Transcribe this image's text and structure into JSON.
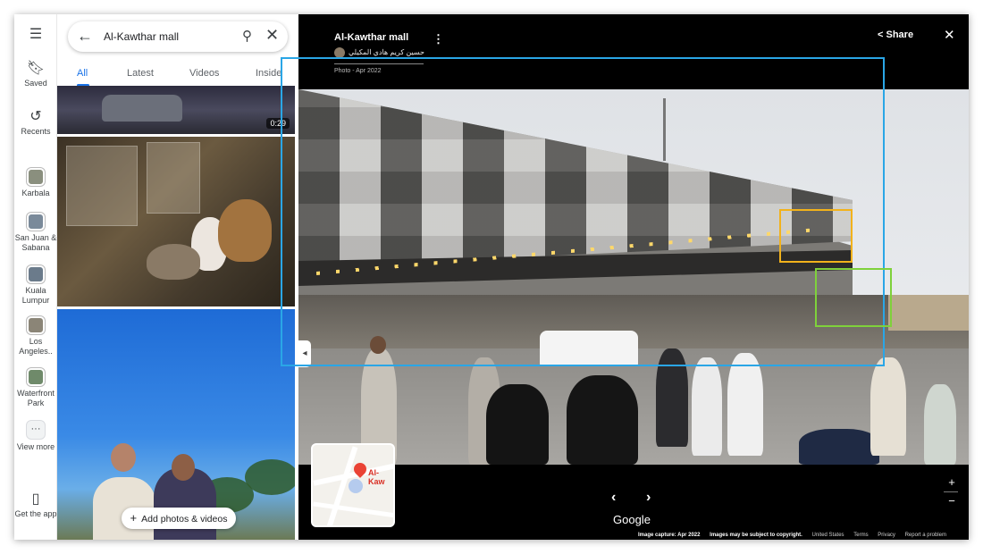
{
  "rail": {
    "items": [
      {
        "label": "Saved",
        "icon": "bookmark-icon"
      },
      {
        "label": "Recents",
        "icon": "history-icon"
      },
      {
        "label": "Karbala",
        "icon": "place-thumbnail"
      },
      {
        "label": "San Juan & Sabana",
        "icon": "place-thumbnail"
      },
      {
        "label": "Kuala Lumpur",
        "icon": "place-thumbnail"
      },
      {
        "label": "Los Angeles..",
        "icon": "place-thumbnail"
      },
      {
        "label": "Waterfront Park",
        "icon": "place-thumbnail"
      },
      {
        "label": "View more",
        "icon": "more-icon"
      },
      {
        "label": "Get the app",
        "icon": "phone-icon"
      }
    ]
  },
  "search": {
    "query": "Al-Kawthar mall"
  },
  "tabs": [
    "All",
    "Latest",
    "Videos",
    "Inside"
  ],
  "active_tab": "All",
  "media": {
    "video_duration": "0:29"
  },
  "add_button": "Add photos & videos",
  "viewer": {
    "title": "Al-Kawthar mall",
    "author": "حسين كريم هادي المكيلي",
    "photo_date": "Photo - Apr 2022",
    "share": "Share",
    "brand": "Google",
    "map_label": "Al-Kaw",
    "footer": {
      "capture": "Image capture: Apr 2022",
      "copyright": "Images may be subject to copyright.",
      "region": "United States",
      "terms": "Terms",
      "privacy": "Privacy",
      "report": "Report a problem"
    }
  },
  "colors": {
    "accent": "#1a73e8",
    "annotation_blue": "#2aa6e6",
    "annotation_orange": "#f2b21b",
    "annotation_green": "#7fd13b"
  }
}
